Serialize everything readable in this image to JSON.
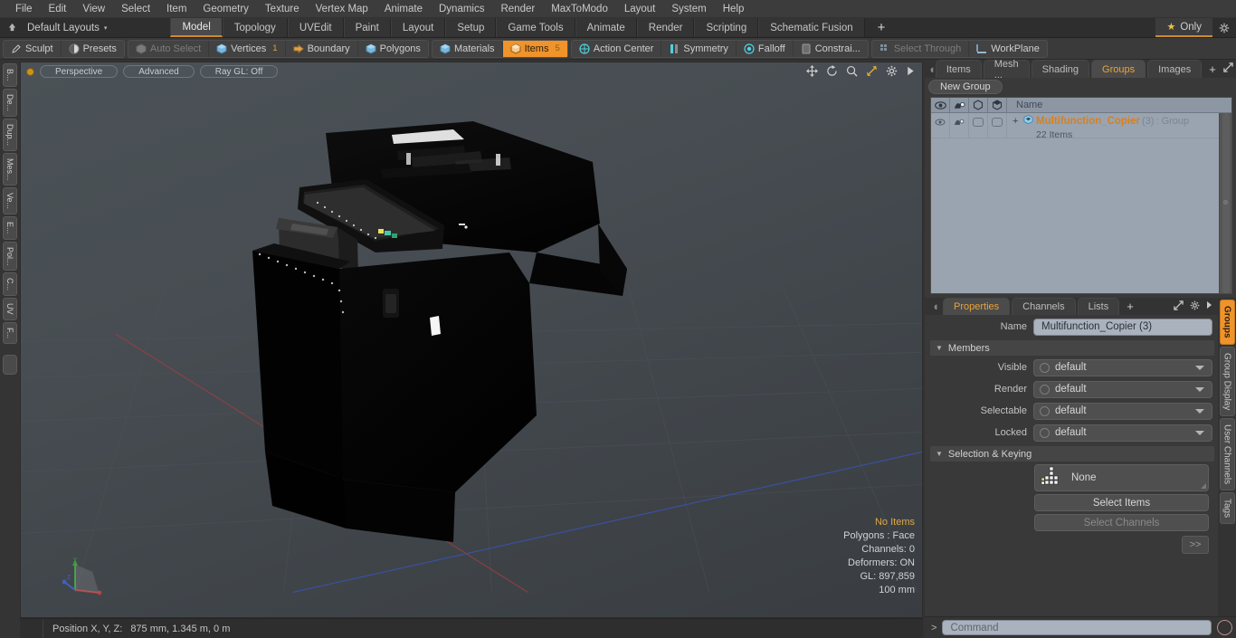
{
  "menubar": {
    "items": [
      "File",
      "Edit",
      "View",
      "Select",
      "Item",
      "Geometry",
      "Texture",
      "Vertex Map",
      "Animate",
      "Dynamics",
      "Render",
      "MaxToModo",
      "Layout",
      "System",
      "Help"
    ]
  },
  "layoutbar": {
    "home_icon": "home-icon",
    "layout_name": "Default Layouts",
    "caret": "▾",
    "tabs": [
      {
        "label": "Model",
        "active": true
      },
      {
        "label": "Topology",
        "active": false
      },
      {
        "label": "UVEdit",
        "active": false
      },
      {
        "label": "Paint",
        "active": false
      },
      {
        "label": "Layout",
        "active": false
      },
      {
        "label": "Setup",
        "active": false
      },
      {
        "label": "Game Tools",
        "active": false
      },
      {
        "label": "Animate",
        "active": false
      },
      {
        "label": "Render",
        "active": false
      },
      {
        "label": "Scripting",
        "active": false
      },
      {
        "label": "Schematic Fusion",
        "active": false
      }
    ],
    "add_tab": "+",
    "only_label": "Only",
    "star_icon": "★",
    "gear_icon": "gear-icon"
  },
  "toolbar": {
    "group1": [
      {
        "label": "Sculpt",
        "icon": "pencil-icon",
        "state": "normal"
      },
      {
        "label": "Presets",
        "icon": "sphere-icon",
        "state": "normal"
      }
    ],
    "group2": [
      {
        "label": "Auto Select",
        "icon": "cube-grey-icon",
        "state": "dim",
        "num": ""
      },
      {
        "label": "Vertices",
        "icon": "cube-blue-icon",
        "state": "normal",
        "num": "1"
      },
      {
        "label": "Boundary",
        "icon": "arrow-cube-icon",
        "state": "normal",
        "num": ""
      },
      {
        "label": "Polygons",
        "icon": "cube-blue-icon",
        "state": "normal",
        "num": ""
      }
    ],
    "group3": [
      {
        "label": "Materials",
        "icon": "cube-blue-icon",
        "state": "normal",
        "num": ""
      },
      {
        "label": "Items",
        "icon": "cube-orange-icon",
        "state": "active",
        "num": "5"
      }
    ],
    "group4": [
      {
        "label": "Action Center",
        "icon": "target-icon",
        "state": "normal"
      },
      {
        "label": "Symmetry",
        "icon": "symmetry-icon",
        "state": "normal"
      },
      {
        "label": "Falloff",
        "icon": "falloff-icon",
        "state": "normal"
      },
      {
        "label": "Constrai...",
        "icon": "constraint-icon",
        "state": "normal"
      }
    ],
    "group5": [
      {
        "label": "Select Through",
        "icon": "select-through-icon",
        "state": "dim"
      },
      {
        "label": "WorkPlane",
        "icon": "workplane-icon",
        "state": "normal"
      }
    ]
  },
  "left_strip": {
    "tabs": [
      "B...",
      "De...",
      "Dup...",
      "Mes...",
      "Ve...",
      "E...",
      "Pol...",
      "C...",
      "UV",
      "F..."
    ]
  },
  "viewport": {
    "chips": [
      "Perspective",
      "Advanced",
      "Ray GL: Off"
    ],
    "icons": [
      "move-icon",
      "rotate-icon",
      "zoom-icon",
      "fit-icon",
      "gear-icon",
      "play-icon"
    ],
    "stats": {
      "selection": "No Items",
      "polygons": "Polygons : Face",
      "channels": "Channels: 0",
      "deformers": "Deformers: ON",
      "gl": "GL: 897,859",
      "scale": "100 mm"
    },
    "axis_labels": {
      "x": "X",
      "y": "Y",
      "z": "Z"
    },
    "colors": {
      "x_axis": "#b04545",
      "y_axis": "#3f9a3f",
      "z_axis": "#4060c0",
      "background": "#474d52"
    }
  },
  "statusbar": {
    "position_label": "Position X, Y, Z:",
    "position_value": "875 mm, 1.345 m, 0 m"
  },
  "right_panel": {
    "tabs": [
      {
        "label": "Items",
        "active": false
      },
      {
        "label": "Mesh ...",
        "active": false
      },
      {
        "label": "Shading",
        "active": false
      },
      {
        "label": "Groups",
        "active": true
      },
      {
        "label": "Images",
        "active": false
      }
    ],
    "add_tab": "+",
    "expand_icon": "expand-icon",
    "more_icon": "chevron-right-icon",
    "new_group_button": "New Group",
    "list_header": {
      "col_icons": [
        "eye-icon",
        "render-icon",
        "cube-outline-icon",
        "cube-shaded-icon"
      ],
      "name_column": "Name"
    },
    "rows": [
      {
        "expander": "+",
        "icon": "group-cube-icon",
        "name": "Multifunction_Copier",
        "count": "(3)",
        "type": ": Group",
        "subtitle": "22 Items"
      }
    ]
  },
  "properties": {
    "tabs": [
      {
        "label": "Properties",
        "active": true
      },
      {
        "label": "Channels",
        "active": false
      },
      {
        "label": "Lists",
        "active": false
      }
    ],
    "add_tab": "+",
    "expand_icon": "expand-icon",
    "gear_icon": "gear-icon",
    "more_icon": "chevron-right-icon",
    "name_label": "Name",
    "name_value": "Multifunction_Copier (3)",
    "members_section": "Members",
    "member_fields": [
      {
        "label": "Visible",
        "value": "default"
      },
      {
        "label": "Render",
        "value": "default"
      },
      {
        "label": "Selectable",
        "value": "default"
      },
      {
        "label": "Locked",
        "value": "default"
      }
    ],
    "selection_section": "Selection & Keying",
    "selection_value": "None",
    "selection_icon": "pixel-grid-icon",
    "select_items_button": "Select Items",
    "select_channels_button": "Select Channels",
    "more_button": ">>",
    "side_tabs": [
      {
        "label": "Groups",
        "active": true
      },
      {
        "label": "Group Display",
        "active": false
      },
      {
        "label": "User Channels",
        "active": false
      },
      {
        "label": "Tags",
        "active": false
      }
    ]
  },
  "command_bar": {
    "prompt": ">",
    "placeholder": "Command",
    "record_icon": "record-circle-icon"
  }
}
